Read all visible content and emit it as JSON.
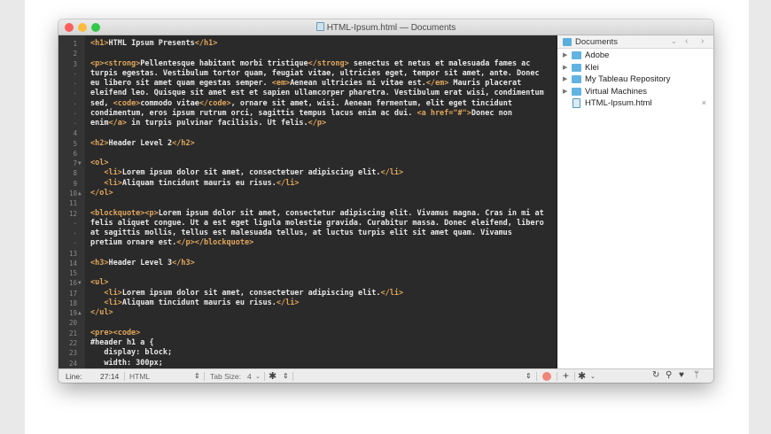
{
  "window": {
    "title": "HTML-Ipsum.html — Documents"
  },
  "editor": {
    "lines": [
      {
        "n": "1",
        "rows": [
          [
            [
              "tag",
              "<h1>"
            ],
            [
              "text",
              "HTML Ipsum Presents"
            ],
            [
              "tag",
              "</h1>"
            ]
          ]
        ]
      },
      {
        "n": "2",
        "rows": [
          []
        ]
      },
      {
        "n": "3",
        "rows": [
          [
            [
              "tag",
              "<p><strong>"
            ],
            [
              "text",
              "Pellentesque habitant morbi tristique"
            ],
            [
              "tag",
              "</strong>"
            ],
            [
              "text",
              " senectus et netus et malesuada fames ac"
            ]
          ],
          [
            [
              "text",
              "turpis egestas. Vestibulum tortor quam, feugiat vitae, ultricies eget, tempor sit amet, ante. Donec"
            ]
          ],
          [
            [
              "text",
              "eu libero sit amet quam egestas semper. "
            ],
            [
              "tag",
              "<em>"
            ],
            [
              "text",
              "Aenean ultricies mi vitae est."
            ],
            [
              "tag",
              "</em>"
            ],
            [
              "text",
              " Mauris placerat"
            ]
          ],
          [
            [
              "text",
              "eleifend leo. Quisque sit amet est et sapien ullamcorper pharetra. Vestibulum erat wisi, condimentum"
            ]
          ],
          [
            [
              "text",
              "sed, "
            ],
            [
              "tag",
              "<code>"
            ],
            [
              "text",
              "commodo vitae"
            ],
            [
              "tag",
              "</code>"
            ],
            [
              "text",
              ", ornare sit amet, wisi. Aenean fermentum, elit eget tincidunt"
            ]
          ],
          [
            [
              "text",
              "condimentum, eros ipsum rutrum orci, sagittis tempus lacus enim ac dui. "
            ],
            [
              "tag",
              "<a href=\"#\">"
            ],
            [
              "text",
              "Donec non"
            ]
          ],
          [
            [
              "text",
              "enim"
            ],
            [
              "tag",
              "</a>"
            ],
            [
              "text",
              " in turpis pulvinar facilisis. Ut felis."
            ],
            [
              "tag",
              "</p>"
            ]
          ]
        ]
      },
      {
        "n": "4",
        "rows": [
          []
        ]
      },
      {
        "n": "5",
        "rows": [
          [
            [
              "tag",
              "<h2>"
            ],
            [
              "text",
              "Header Level 2"
            ],
            [
              "tag",
              "</h2>"
            ]
          ]
        ]
      },
      {
        "n": "6",
        "rows": [
          []
        ]
      },
      {
        "n": "7",
        "fold": "▼",
        "rows": [
          [
            [
              "tag",
              "<ol>"
            ]
          ]
        ]
      },
      {
        "n": "8",
        "rows": [
          [
            [
              "text",
              "   "
            ],
            [
              "tag",
              "<li>"
            ],
            [
              "text",
              "Lorem ipsum dolor sit amet, consectetuer adipiscing elit."
            ],
            [
              "tag",
              "</li>"
            ]
          ]
        ]
      },
      {
        "n": "9",
        "rows": [
          [
            [
              "text",
              "   "
            ],
            [
              "tag",
              "<li>"
            ],
            [
              "text",
              "Aliquam tincidunt mauris eu risus."
            ],
            [
              "tag",
              "</li>"
            ]
          ]
        ]
      },
      {
        "n": "10",
        "fold": "▲",
        "rows": [
          [
            [
              "tag",
              "</ol>"
            ]
          ]
        ]
      },
      {
        "n": "11",
        "rows": [
          []
        ]
      },
      {
        "n": "12",
        "rows": [
          [
            [
              "tag",
              "<blockquote><p>"
            ],
            [
              "text",
              "Lorem ipsum dolor sit amet, consectetur adipiscing elit. Vivamus magna. Cras in mi at"
            ]
          ],
          [
            [
              "text",
              "felis aliquet congue. Ut a est eget ligula molestie gravida. Curabitur massa. Donec eleifend, libero"
            ]
          ],
          [
            [
              "text",
              "at sagittis mollis, tellus est malesuada tellus, at luctus turpis elit sit amet quam. Vivamus"
            ]
          ],
          [
            [
              "text",
              "pretium ornare est."
            ],
            [
              "tag",
              "</p></blockquote>"
            ]
          ]
        ]
      },
      {
        "n": "13",
        "rows": [
          []
        ]
      },
      {
        "n": "14",
        "rows": [
          [
            [
              "tag",
              "<h3>"
            ],
            [
              "text",
              "Header Level 3"
            ],
            [
              "tag",
              "</h3>"
            ]
          ]
        ]
      },
      {
        "n": "15",
        "rows": [
          []
        ]
      },
      {
        "n": "16",
        "fold": "▼",
        "rows": [
          [
            [
              "tag",
              "<ul>"
            ]
          ]
        ]
      },
      {
        "n": "17",
        "rows": [
          [
            [
              "text",
              "   "
            ],
            [
              "tag",
              "<li>"
            ],
            [
              "text",
              "Lorem ipsum dolor sit amet, consectetuer adipiscing elit."
            ],
            [
              "tag",
              "</li>"
            ]
          ]
        ]
      },
      {
        "n": "18",
        "rows": [
          [
            [
              "text",
              "   "
            ],
            [
              "tag",
              "<li>"
            ],
            [
              "text",
              "Aliquam tincidunt mauris eu risus."
            ],
            [
              "tag",
              "</li>"
            ]
          ]
        ]
      },
      {
        "n": "19",
        "fold": "▲",
        "rows": [
          [
            [
              "tag",
              "</ul>"
            ]
          ]
        ]
      },
      {
        "n": "20",
        "rows": [
          []
        ]
      },
      {
        "n": "21",
        "rows": [
          [
            [
              "tag",
              "<pre><code>"
            ]
          ]
        ]
      },
      {
        "n": "22",
        "rows": [
          [
            [
              "text",
              "#header h1 a {"
            ]
          ]
        ]
      },
      {
        "n": "23",
        "rows": [
          [
            [
              "text",
              "   display: block;"
            ]
          ]
        ]
      },
      {
        "n": "24",
        "rows": [
          [
            [
              "text",
              "   width: 300px;"
            ]
          ]
        ]
      }
    ]
  },
  "sidebar": {
    "header": "Documents",
    "items": [
      {
        "type": "folder",
        "name": "Adobe"
      },
      {
        "type": "folder",
        "name": "Klei"
      },
      {
        "type": "folder",
        "name": "My Tableau Repository"
      },
      {
        "type": "folder",
        "name": "Virtual Machines"
      },
      {
        "type": "file",
        "name": "HTML-Ipsum.html",
        "close": "×"
      }
    ]
  },
  "status": {
    "line_label": "Line:",
    "position": "27:14",
    "syntax": "HTML",
    "tab_size_label": "Tab Size:",
    "tab_size": "4"
  },
  "colors": {
    "close": "#fc605b",
    "minimize": "#fdbc40",
    "zoom": "#34c84a",
    "tag": "#e0a65c",
    "record": "#f0857a"
  }
}
